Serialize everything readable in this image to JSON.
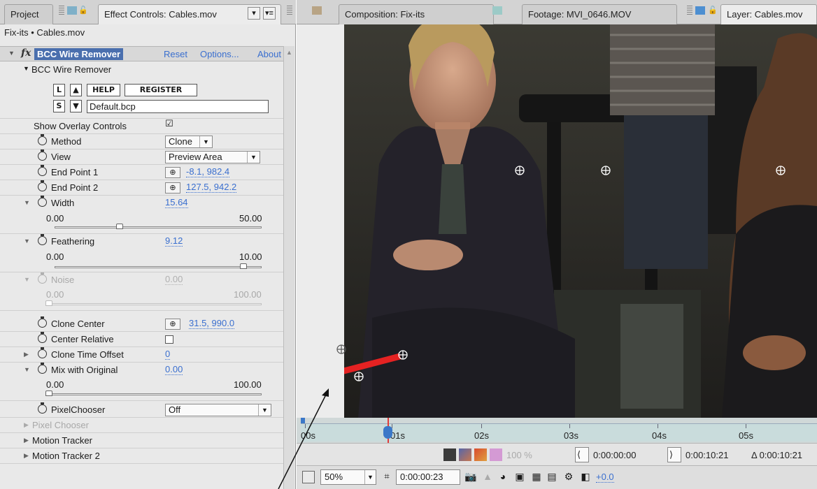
{
  "left_panel": {
    "tabs": {
      "project": "Project",
      "effect_controls": "Effect Controls: Cables.mov"
    },
    "breadcrumb": "Fix-its • Cables.mov",
    "effect": {
      "name": "BCC Wire Remover",
      "reset": "Reset",
      "options": "Options...",
      "about": "About"
    },
    "section_title": "BCC Wire Remover",
    "preset": {
      "load": "L",
      "save": "S",
      "help": "HELP",
      "register": "REGISTER",
      "file": "Default.bcp"
    },
    "properties": {
      "show_overlay": {
        "label": "Show Overlay Controls",
        "checked": "☑"
      },
      "method": {
        "label": "Method",
        "value": "Clone"
      },
      "view": {
        "label": "View",
        "value": "Preview Area"
      },
      "end_point_1": {
        "label": "End Point 1",
        "value": "-8.1, 982.4"
      },
      "end_point_2": {
        "label": "End Point 2",
        "value": "127.5, 942.2"
      },
      "width": {
        "label": "Width",
        "value": "15.64",
        "min": "0.00",
        "max": "50.00",
        "fraction": 0.3128
      },
      "feathering": {
        "label": "Feathering",
        "value": "9.12",
        "min": "0.00",
        "max": "10.00",
        "fraction": 0.912
      },
      "noise": {
        "label": "Noise",
        "value": "0.00",
        "min": "0.00",
        "max": "100.00",
        "fraction": 0.0
      },
      "clone_center": {
        "label": "Clone Center",
        "value": "31.5, 990.0"
      },
      "center_relative": {
        "label": "Center Relative"
      },
      "clone_time_offset": {
        "label": "Clone Time Offset",
        "value": "0"
      },
      "mix_with_original": {
        "label": "Mix with Original",
        "value": "0.00",
        "min": "0.00",
        "max": "100.00",
        "fraction": 0.0
      },
      "pixel_chooser_popup": {
        "label": "PixelChooser",
        "value": "Off"
      },
      "pixel_chooser_group": "Pixel Chooser",
      "motion_tracker": "Motion Tracker",
      "motion_tracker_2": "Motion Tracker 2"
    }
  },
  "right_panel": {
    "tabs": {
      "composition": "Composition: Fix-its",
      "footage": "Footage: MVI_0646.MOV",
      "layer": "Layer: Cables.mov"
    },
    "timeline": {
      "labels": [
        "00s",
        "01s",
        "02s",
        "03s",
        "04s",
        "05s"
      ]
    },
    "toolbar1": {
      "opacity": "100 %",
      "in_time": "0:00:00:00",
      "out_time": "0:00:10:21",
      "duration": "Δ 0:00:10:21"
    },
    "toolbar2": {
      "zoom": "50%",
      "timecode": "0:00:00:23",
      "exposure": "+0.0"
    }
  },
  "colors": {
    "selection_blue": "#4a6fae",
    "link_blue": "#3a6fcf",
    "wire_red": "#e52222",
    "playhead_red": "#e03b3b",
    "timeline_teal": "#c9dcdc"
  }
}
